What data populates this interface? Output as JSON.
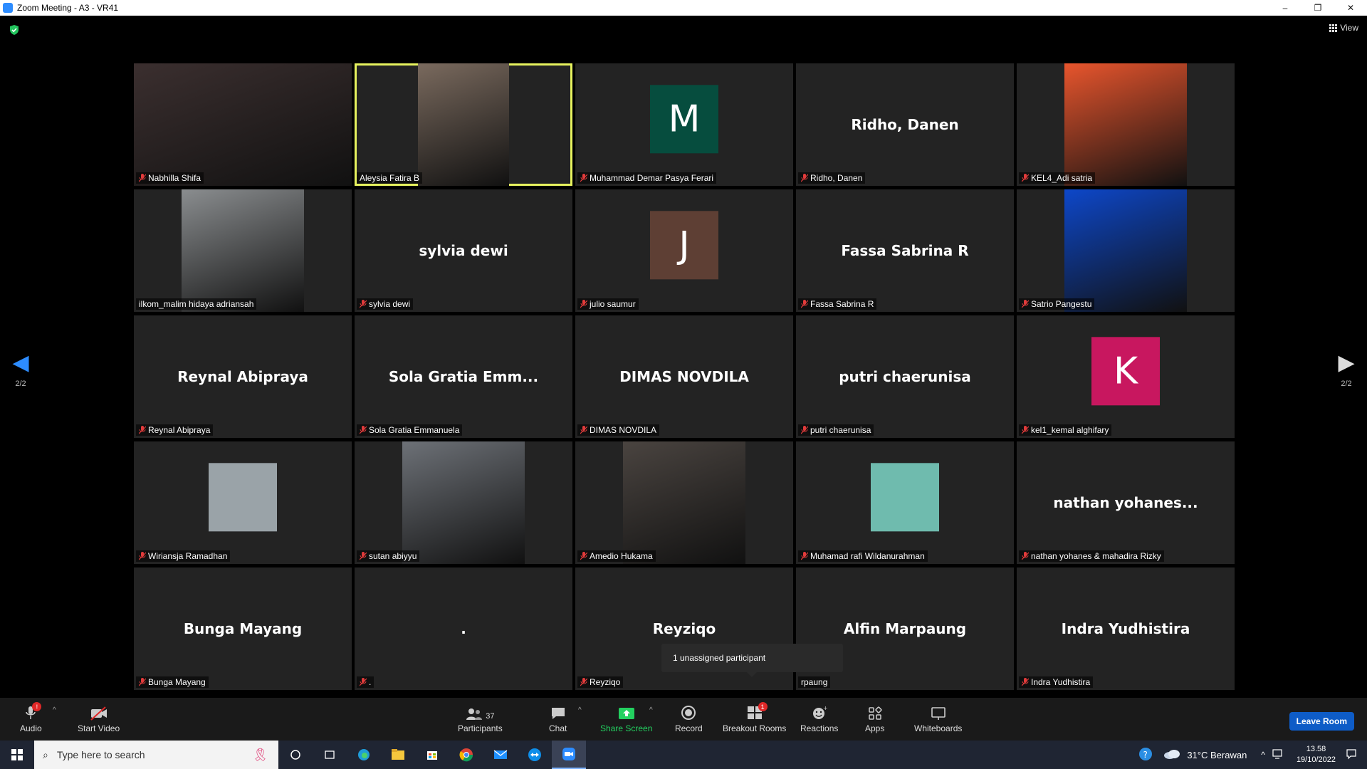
{
  "window": {
    "title": "Zoom Meeting - A3 - VR41",
    "minimize": "–",
    "restore": "❐",
    "close": "✕"
  },
  "view_label": "View",
  "pager": {
    "left": "2/2",
    "right": "2/2"
  },
  "tiles": [
    {
      "label": "Nabhilla Shifa",
      "muted": true,
      "type": "video",
      "color": "#3b2f2f"
    },
    {
      "label": "Aleysia Fatira B",
      "muted": false,
      "type": "video",
      "color": "#7a6a5e",
      "active": true
    },
    {
      "label": "Muhammad Demar Pasya Ferari",
      "muted": true,
      "type": "avatar",
      "letter": "M",
      "color": "#064d3e"
    },
    {
      "label": "Ridho, Danen",
      "muted": true,
      "type": "name",
      "big": "Ridho, Danen"
    },
    {
      "label": "KEL4_Adi satria",
      "muted": true,
      "type": "video",
      "color": "#e8552d"
    },
    {
      "label": "ilkom_malim hidaya adriansah",
      "muted": false,
      "type": "video",
      "color": "#8a8d8f"
    },
    {
      "label": "sylvia dewi",
      "muted": true,
      "type": "name",
      "big": "sylvia dewi"
    },
    {
      "label": "julio saumur",
      "muted": true,
      "type": "avatar",
      "letter": "J",
      "color": "#5e3f34"
    },
    {
      "label": "Fassa Sabrina R",
      "muted": true,
      "type": "name",
      "big": "Fassa Sabrina R"
    },
    {
      "label": "Satrio Pangestu",
      "muted": true,
      "type": "video",
      "color": "#0d47c9"
    },
    {
      "label": "Reynal Abipraya",
      "muted": true,
      "type": "name",
      "big": "Reynal Abipraya"
    },
    {
      "label": "Sola Gratia Emmanuela",
      "muted": true,
      "type": "name",
      "big": "Sola Gratia Emm..."
    },
    {
      "label": "DIMAS NOVDILA",
      "muted": true,
      "type": "name",
      "big": "DIMAS NOVDILA"
    },
    {
      "label": "putri chaerunisa",
      "muted": true,
      "type": "name",
      "big": "putri chaerunisa"
    },
    {
      "label": "kel1_kemal alghifary",
      "muted": true,
      "type": "avatar",
      "letter": "K",
      "color": "#c8175f"
    },
    {
      "label": "Wiriansja Ramadhan",
      "muted": true,
      "type": "photo",
      "color": "#9aa3a8"
    },
    {
      "label": "sutan abiyyu",
      "muted": true,
      "type": "video",
      "color": "#6d7177"
    },
    {
      "label": "Amedio Hukama",
      "muted": true,
      "type": "video",
      "color": "#4a4440"
    },
    {
      "label": "Muhamad rafi Wildanurahman",
      "muted": true,
      "type": "photo",
      "color": "#6fbbae"
    },
    {
      "label": "nathan yohanes & mahadira Rizky",
      "muted": true,
      "type": "name",
      "big": "nathan  yohanes..."
    },
    {
      "label": "Bunga Mayang",
      "muted": true,
      "type": "name",
      "big": "Bunga Mayang"
    },
    {
      "label": ".",
      "muted": true,
      "type": "name",
      "big": "."
    },
    {
      "label": "Reyziqo",
      "muted": true,
      "type": "name",
      "big": "Reyziqo"
    },
    {
      "label": "rpaung",
      "muted": false,
      "type": "name",
      "big": "Alfin Marpaung"
    },
    {
      "label": "Indra Yudhistira",
      "muted": true,
      "type": "name",
      "big": "Indra Yudhistira"
    }
  ],
  "tooltip": "1 unassigned participant",
  "toolbar": {
    "audio": "Audio",
    "start_video": "Start Video",
    "participants": "Participants",
    "participants_count": "37",
    "chat": "Chat",
    "share_screen": "Share Screen",
    "record": "Record",
    "breakout_rooms": "Breakout Rooms",
    "breakout_badge": "1",
    "reactions": "Reactions",
    "apps": "Apps",
    "whiteboards": "Whiteboards",
    "leave": "Leave Room",
    "audio_badge": "!"
  },
  "taskbar": {
    "search_placeholder": "Type here to search",
    "weather": "31°C  Berawan",
    "time": "13.58",
    "date": "19/10/2022"
  }
}
